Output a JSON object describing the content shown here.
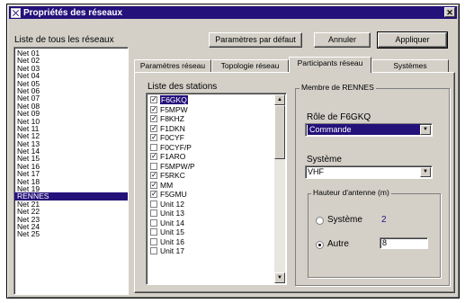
{
  "window": {
    "title": "Propriétés des réseaux",
    "close_glyph": "✕"
  },
  "networks": {
    "label": "Liste de tous les réseaux",
    "items": [
      "Net 01",
      "Net 02",
      "Net 03",
      "Net 04",
      "Net 05",
      "Net 06",
      "Net 07",
      "Net 08",
      "Net 09",
      "Net 10",
      "Net 11",
      "Net 12",
      "Net 13",
      "Net 14",
      "Net 15",
      "Net 16",
      "Net 17",
      "Net 18",
      "Net 19",
      "RENNES",
      "Net 21",
      "Net 22",
      "Net 23",
      "Net 24",
      "Net 25"
    ],
    "selected_index": 19
  },
  "toolbar": {
    "defaults_label": "Paramètres par défaut",
    "cancel_label": "Annuler",
    "apply_label": "Appliquer"
  },
  "tabs": [
    "Paramètres réseau",
    "Topologie réseau",
    "Participants réseau",
    "Systèmes"
  ],
  "active_tab": 2,
  "stations": {
    "label": "Liste des stations",
    "items": [
      {
        "name": "F6GKQ",
        "checked": true,
        "selected": true
      },
      {
        "name": "F5MPW",
        "checked": true
      },
      {
        "name": "F8KHZ",
        "checked": true
      },
      {
        "name": "F1DKN",
        "checked": true
      },
      {
        "name": "F0CYF",
        "checked": true
      },
      {
        "name": "F0CYF/P",
        "checked": false
      },
      {
        "name": "F1ARO",
        "checked": true
      },
      {
        "name": "F5MPW/P",
        "checked": false
      },
      {
        "name": "F5RKC",
        "checked": true
      },
      {
        "name": "MM",
        "checked": true
      },
      {
        "name": "F5GMU",
        "checked": true
      },
      {
        "name": "Unit 12",
        "checked": false
      },
      {
        "name": "Unit 13",
        "checked": false
      },
      {
        "name": "Unit 14",
        "checked": false
      },
      {
        "name": "Unit 15",
        "checked": false
      },
      {
        "name": "Unit 16",
        "checked": false
      },
      {
        "name": "Unit 17",
        "checked": false
      }
    ]
  },
  "member": {
    "title": "Membre de RENNES",
    "role_label": "Rôle de F6GKQ",
    "role_value": "Commande",
    "system_label": "Système",
    "system_value": "VHF",
    "antenna": {
      "title": "Hauteur d'antenne (m)",
      "system_option": "Système",
      "system_value": "2",
      "other_option": "Autre",
      "other_value": "8"
    }
  },
  "colors": {
    "selection": "#24117a",
    "face": "#d4d0c8",
    "accent_text": "#24117a"
  }
}
